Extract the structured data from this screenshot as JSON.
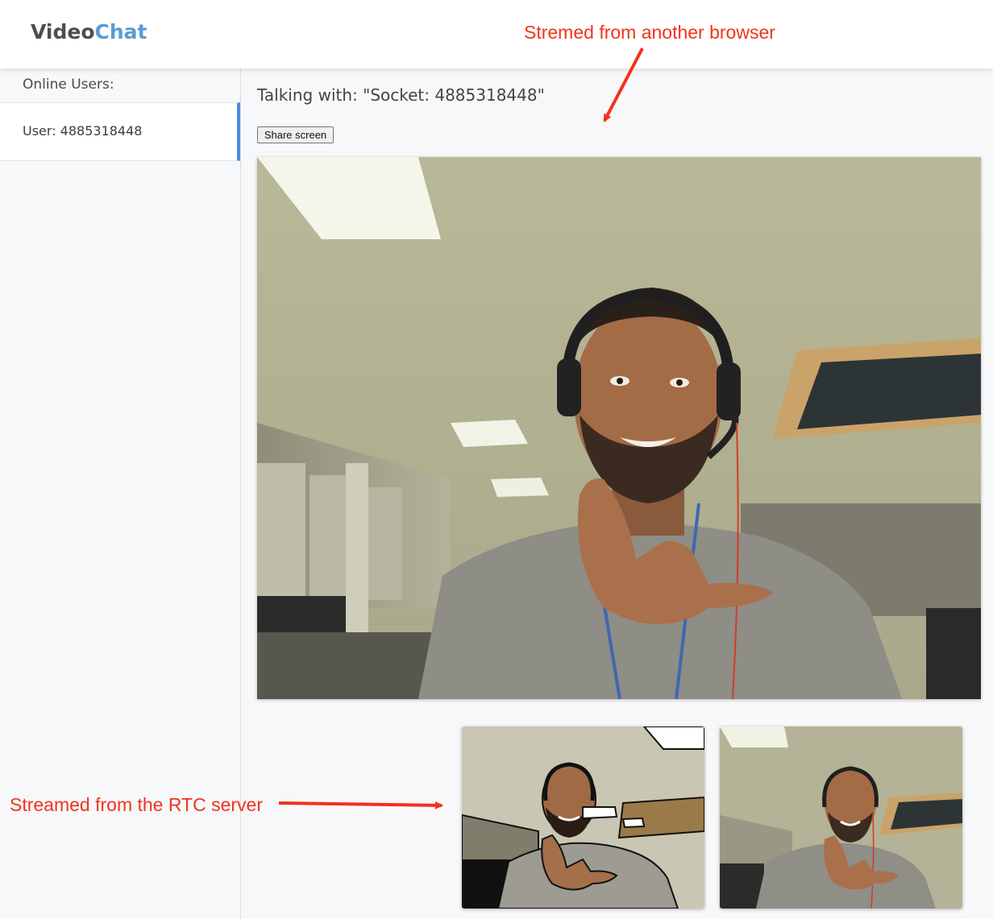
{
  "header": {
    "logo_part1": "Video",
    "logo_part2": "Chat"
  },
  "sidebar": {
    "title": "Online Users:",
    "users": [
      {
        "label": "User: 4885318448"
      }
    ]
  },
  "main": {
    "talking_with": "Talking with: \"Socket: 4885318448\"",
    "share_button": "Share screen"
  },
  "annotations": {
    "top": "Stremed from another browser",
    "bottom": "Streamed from the RTC server"
  },
  "colors": {
    "accent": "#5b9bd5",
    "annotation": "#f2321c",
    "active_border": "#4a90d9"
  }
}
